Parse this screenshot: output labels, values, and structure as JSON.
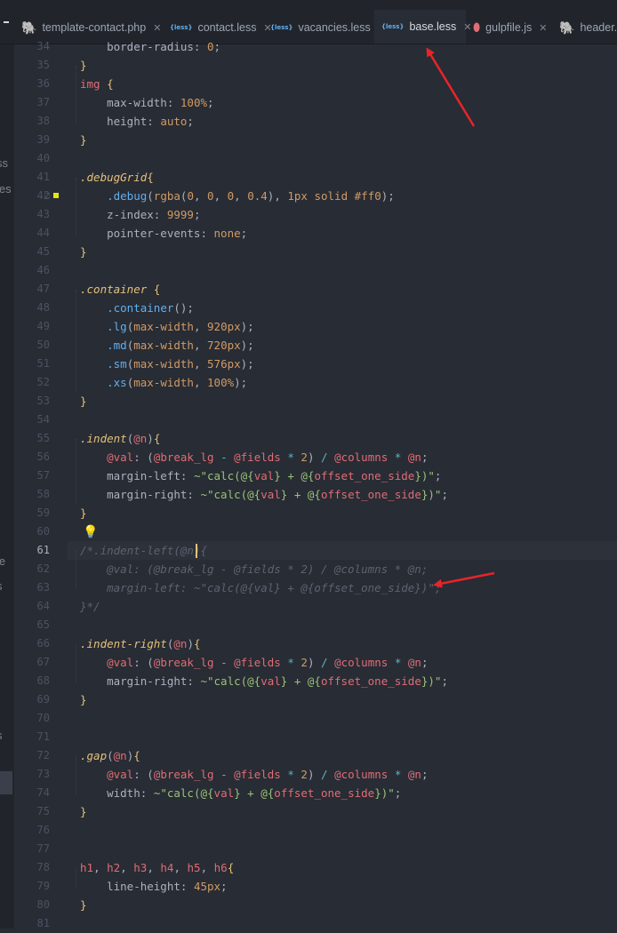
{
  "tabs": [
    {
      "label": "template-contact.php",
      "icon": "elephant-php-icon",
      "active": false
    },
    {
      "label": "contact.less",
      "icon": "less-file-icon",
      "active": false
    },
    {
      "label": "vacancies.less",
      "icon": "less-file-icon",
      "active": false
    },
    {
      "label": "base.less",
      "icon": "less-file-icon",
      "active": true
    },
    {
      "label": "gulpfile.js",
      "icon": "gulp-js-icon",
      "active": false
    },
    {
      "label": "header.p",
      "icon": "elephant-php-icon",
      "active": false
    }
  ],
  "sidebar_fragments": [
    "ss",
    "les",
    "le",
    "s",
    "s"
  ],
  "code": {
    "first_line_number": 34,
    "current_line": 61,
    "lines": [
      "    border-radius: 0;",
      "}",
      "img {",
      "    max-width: 100%;",
      "    height: auto;",
      "}",
      "",
      ".debugGrid{",
      "    .debug(rgba(0, 0, 0, 0.4), 1px solid #ff0);",
      "    z-index: 9999;",
      "    pointer-events: none;",
      "}",
      "",
      ".container {",
      "    .container();",
      "    .lg(max-width, 920px);",
      "    .md(max-width, 720px);",
      "    .sm(max-width, 576px);",
      "    .xs(max-width, 100%);",
      "}",
      "",
      ".indent(@n){",
      "    @val: (@break_lg - @fields * 2) / @columns * @n;",
      "    margin-left: ~\"calc(@{val} + @{offset_one_side})\";",
      "    margin-right: ~\"calc(@{val} + @{offset_one_side})\";",
      "}",
      "",
      "/*.indent-left(@n){",
      "    @val: (@break_lg - @fields * 2) / @columns * @n;",
      "    margin-left: ~\"calc(@{val} + @{offset_one_side})\";",
      "}*/",
      "",
      ".indent-right(@n){",
      "    @val: (@break_lg - @fields * 2) / @columns * @n;",
      "    margin-right: ~\"calc(@{val} + @{offset_one_side})\";",
      "}",
      "",
      "",
      ".gap(@n){",
      "    @val: (@break_lg - @fields * 2) / @columns * @n;",
      "    width: ~\"calc(@{val} + @{offset_one_side})\";",
      "}",
      "",
      "",
      "h1, h2, h3, h4, h5, h6{",
      "    line-height: 45px;",
      "}",
      ""
    ]
  },
  "colors": {
    "background": "#282c34",
    "tab_active_underline": "#e06c75",
    "annotation_arrow": "#e8242a",
    "selector": "#e5c07b",
    "function": "#61afef",
    "number": "#d19a66",
    "string": "#98c379",
    "variable": "#e06c75",
    "comment": "#5c6370"
  },
  "icons": {
    "lightbulb": "lightbulb-icon",
    "close": "close-icon"
  }
}
